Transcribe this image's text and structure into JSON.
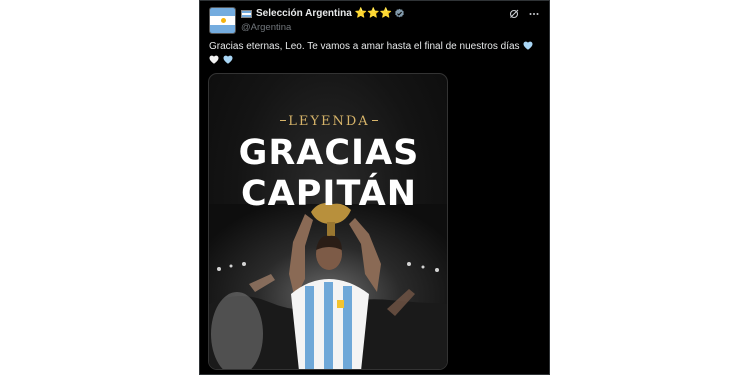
{
  "tweet": {
    "display_name": "Selección Argentina",
    "stars": "⭐⭐⭐",
    "handle": "@Argentina",
    "text": "Gracias eternas, Leo. Te vamos a amar hasta el final de nuestros días",
    "icons": [
      "argentina-flag-icon",
      "star-icon",
      "verified-badge-icon",
      "grok-icon",
      "more-icon",
      "light-blue-heart-icon",
      "white-heart-icon"
    ]
  },
  "media": {
    "kicker": "LEYENDA",
    "headline_1": "GRACIAS",
    "headline_2": "CAPITÁN"
  },
  "colors": {
    "background": "#000000",
    "primary_text": "#e7e9ea",
    "secondary_text": "#71767b",
    "gold": "#d8b56a",
    "argentina_blue": "#74acdf",
    "verified": "#829aab"
  }
}
